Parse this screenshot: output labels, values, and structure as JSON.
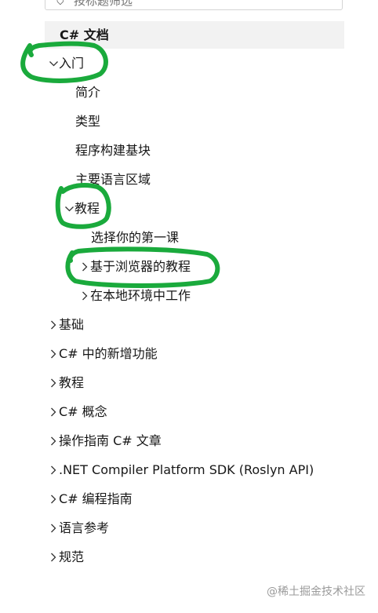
{
  "search": {
    "placeholder": "按标题筛选"
  },
  "toc": {
    "header": "C# 文档"
  },
  "tree": {
    "intro": {
      "label": "入门"
    },
    "intro_overview": {
      "label": "简介"
    },
    "intro_types": {
      "label": "类型"
    },
    "intro_building_blocks": {
      "label": "程序构建基块"
    },
    "intro_language_areas": {
      "label": "主要语言区域"
    },
    "tutorials": {
      "label": "教程"
    },
    "tutorials_first_lesson": {
      "label": "选择你的第一课"
    },
    "tutorials_browser": {
      "label": "基于浏览器的教程"
    },
    "tutorials_local": {
      "label": "在本地环境中工作"
    },
    "fundamentals": {
      "label": "基础"
    },
    "whats_new": {
      "label": "C# 中的新增功能"
    },
    "tutorials_top": {
      "label": "教程"
    },
    "concepts": {
      "label": "C# 概念"
    },
    "howto": {
      "label": "操作指南 C# 文章"
    },
    "roslyn": {
      "label": ".NET Compiler Platform SDK (Roslyn API)"
    },
    "programming_guide": {
      "label": "C# 编程指南"
    },
    "language_reference": {
      "label": "语言参考"
    },
    "specification": {
      "label": "规范"
    }
  },
  "watermark": "@稀土掘金技术社区",
  "colors": {
    "annotation": "#1aaa3c",
    "header_bg": "#f2f2f2"
  }
}
